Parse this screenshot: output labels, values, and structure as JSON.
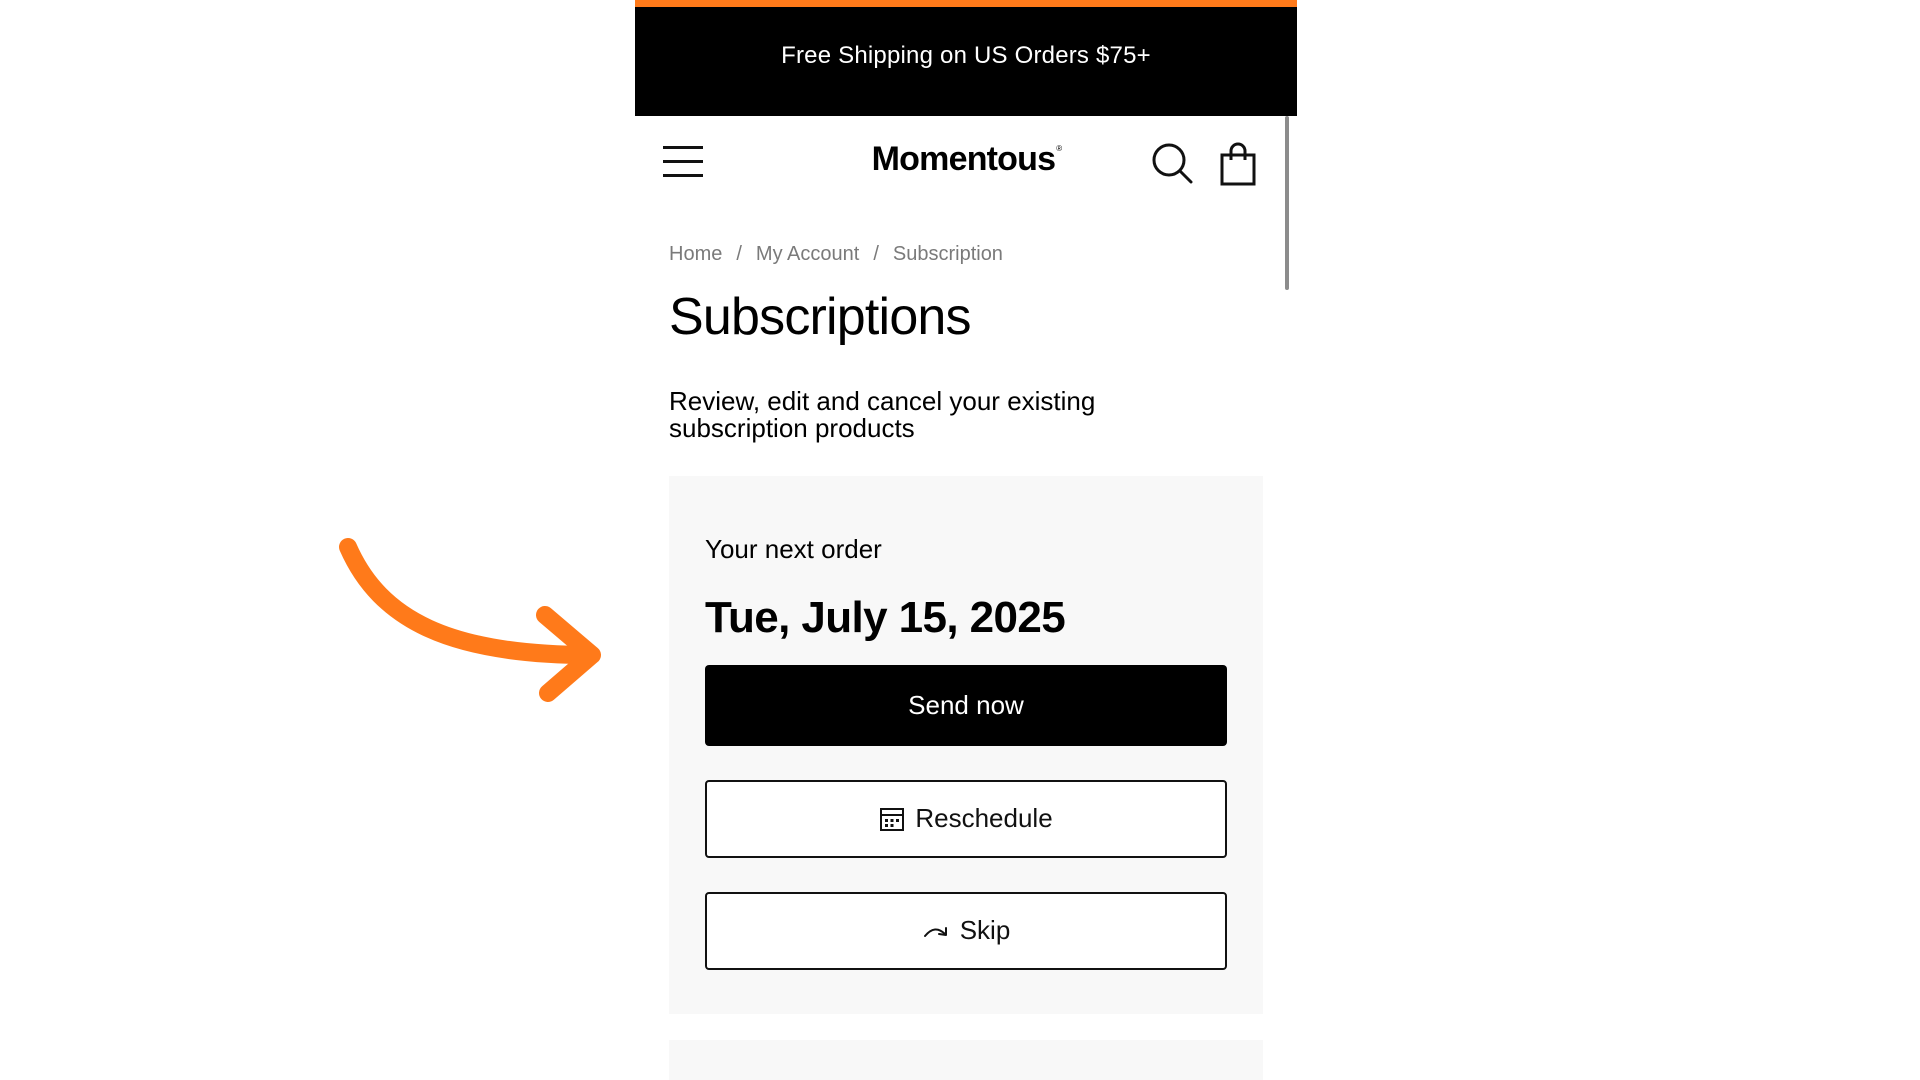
{
  "promo": {
    "text": "Free Shipping on US Orders $75+"
  },
  "header": {
    "logo": "Momentous",
    "logo_mark": "®",
    "menu_icon": "hamburger-menu-icon",
    "search_icon": "search-icon",
    "cart_icon": "shopping-bag-icon"
  },
  "breadcrumb": {
    "items": [
      "Home",
      "My Account",
      "Subscription"
    ],
    "separator": "/"
  },
  "page": {
    "title": "Subscriptions",
    "subtitle": "Review, edit and cancel your existing subscription products"
  },
  "next_order": {
    "label": "Your next order",
    "date": "Tue, July 15, 2025",
    "send_now_label": "Send now",
    "reschedule_label": "Reschedule",
    "reschedule_icon": "calendar-icon",
    "skip_label": "Skip",
    "skip_icon": "skip-arrow-icon"
  },
  "colors": {
    "accent": "#ff7a1a",
    "promo_bg": "#000000",
    "card_bg": "#f8f8f8",
    "breadcrumb_text": "#7a7a7a"
  },
  "annotation": {
    "icon": "curved-arrow-icon"
  }
}
